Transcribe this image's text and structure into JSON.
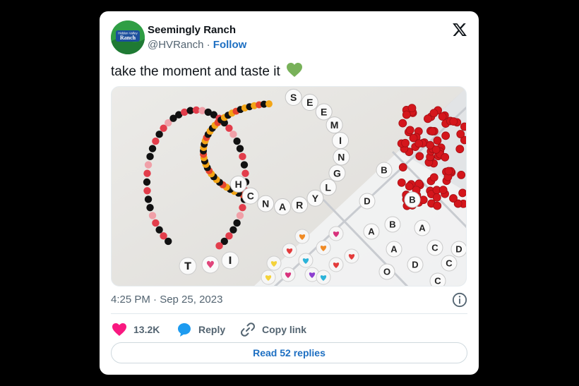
{
  "author": {
    "display_name": "Seemingly Ranch",
    "handle": "@HVRanch",
    "separator": "·",
    "follow_label": "Follow",
    "avatar_text_top": "Hidden Valley",
    "avatar_text_main": "Ranch"
  },
  "brand_icon": "x-logo-icon",
  "tweet": {
    "text": "take the moment and taste it",
    "emoji_icon": "green-heart-icon",
    "image_icon": "friendship-bracelets-photo"
  },
  "photo": {
    "bracelet_1_letters": [
      "S",
      "E",
      "E",
      "M",
      "I",
      "N",
      "G",
      "L",
      "Y",
      "R",
      "A",
      "N",
      "C",
      "H"
    ],
    "bracelet_2_letters": [
      "T",
      "I"
    ],
    "tray_letters": [
      "B",
      "D",
      "B",
      "B",
      "A",
      "A",
      "A",
      "C",
      "D",
      "C",
      "O",
      "C",
      "D"
    ]
  },
  "meta": {
    "timestamp": "4:25 PM · Sep 25, 2023",
    "info_icon": "info-icon"
  },
  "actions": {
    "like_count": "13.2K",
    "reply_label": "Reply",
    "copy_link_label": "Copy link"
  },
  "read_replies_label": "Read 52 replies",
  "colors": {
    "like": "#f91880",
    "reply": "#1d9bf0",
    "link_blue": "#1d6fc2",
    "emoji_green": "#78b159"
  }
}
